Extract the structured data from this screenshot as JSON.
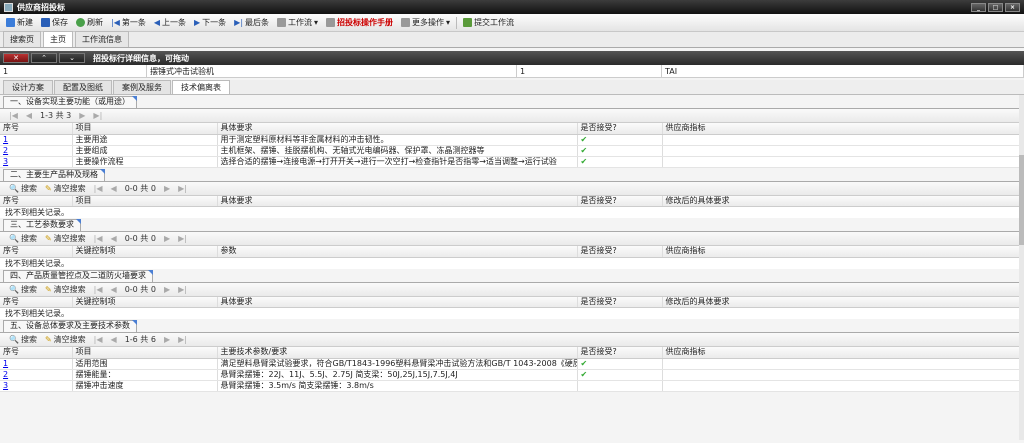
{
  "window": {
    "title": "供应商招投标"
  },
  "toolbar": {
    "new": "新建",
    "save": "保存",
    "refresh": "刷新",
    "first": "第一条",
    "prev": "上一条",
    "next": "下一条",
    "last": "最后条",
    "workflow": "工作流",
    "manual": "招投标操作手册",
    "more": "更多操作",
    "submit": "提交工作流"
  },
  "tabs": [
    "搜索页",
    "主页",
    "工作流信息"
  ],
  "detail": {
    "title": "招投标行详细信息，可拖动",
    "row": [
      "1",
      "摆锤式冲击试验机",
      "1",
      "TAI"
    ]
  },
  "subtabs": [
    "设计方案",
    "配置及图纸",
    "案例及服务",
    "技术偏离表"
  ],
  "pager": {
    "search": "搜索",
    "clear": "清空搜索",
    "range1": "1-3 共 3",
    "range0": "0-0 共 0",
    "range6": "1-6 共 6"
  },
  "empty": "找不到相关记录。",
  "sec1": {
    "title": "一、设备实现主要功能（或用途）",
    "headers": [
      "序号",
      "项目",
      "具体要求",
      "是否接受?",
      "供应商指标"
    ],
    "rows": [
      [
        "1",
        "主要用途",
        "用于测定塑料原材料等非金属材料的冲击韧性。"
      ],
      [
        "2",
        "主要组成",
        "主机框架、摆锤、挂脱摆机构、无轴式光电编码器、保护罩、冻晶测控器等"
      ],
      [
        "3",
        "主要操作流程",
        "选择合适的摆锤→连接电源→打开开关→进行一次空打→检查指针是否指零→适当调整→运行试验"
      ]
    ]
  },
  "sec2": {
    "title": "二、主要生产品种及规格",
    "headers": [
      "序号",
      "项目",
      "具体要求",
      "是否接受?",
      "修改后的具体要求"
    ]
  },
  "sec3": {
    "title": "三、工艺参数要求",
    "headers": [
      "序号",
      "关键控制项",
      "参数",
      "是否接受?",
      "供应商指标"
    ]
  },
  "sec4": {
    "title": "四、产品质量管控点及二道防火墙要求",
    "headers": [
      "序号",
      "关键控制项",
      "具体要求",
      "是否接受?",
      "修改后的具体要求"
    ]
  },
  "sec5": {
    "title": "五、设备总体要求及主要技术参数",
    "headers": [
      "序号",
      "项目",
      "主要技术参数/要求",
      "是否接受?",
      "供应商指标"
    ],
    "rows": [
      [
        "1",
        "适用范围",
        "满足塑料悬臂梁试验要求，符合GB/T1843-1996塑料悬臂梁冲击试验方法和GB/T 1043-2008《硬质塑"
      ],
      [
        "2",
        "摆锤能量：",
        "悬臂梁摆锤：22J、11J、5.5J、2.75J 简支梁：50J,25J,15J,7.5J,4J"
      ],
      [
        "3",
        "摆锤冲击速度",
        "悬臂梁摆锤：3.5m/s 简支梁摆锤：3.8m/s"
      ]
    ]
  }
}
